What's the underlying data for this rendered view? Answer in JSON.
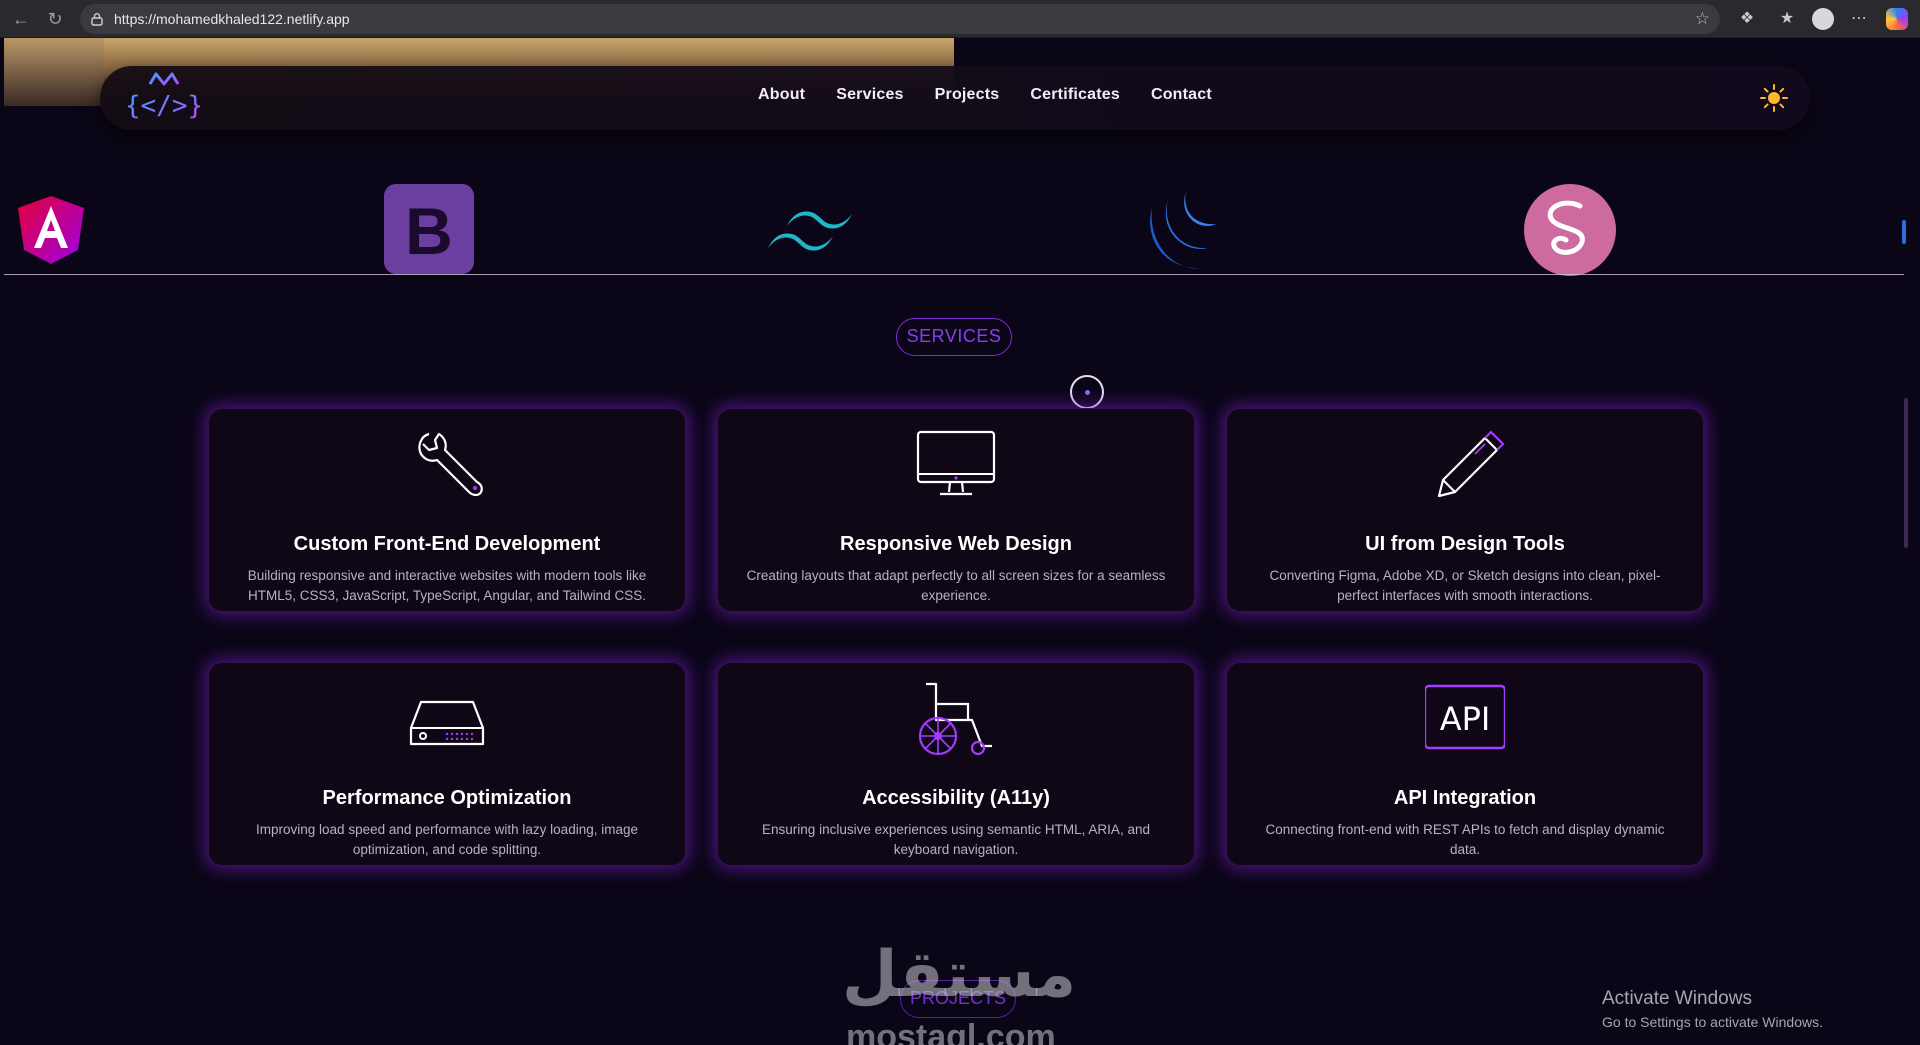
{
  "browser": {
    "url": "https://mohamedkhaled122.netlify.app",
    "back_icon": "arrow-left-icon",
    "reload_icon": "reload-icon"
  },
  "nav": {
    "links": [
      "About",
      "Services",
      "Projects",
      "Certificates",
      "Contact"
    ],
    "theme_icon": "sun-icon"
  },
  "tech_logos": [
    "angular-logo",
    "bootstrap-logo",
    "tailwind-logo",
    "jquery-logo",
    "sass-logo"
  ],
  "bootstrap_letter": "B",
  "services": {
    "badge": "SERVICES",
    "cards": [
      {
        "icon": "wrench-icon",
        "title": "Custom Front-End Development",
        "desc": "Building responsive and interactive websites with modern tools like HTML5, CSS3, JavaScript, TypeScript, Angular, and Tailwind CSS."
      },
      {
        "icon": "monitor-icon",
        "title": "Responsive Web Design",
        "desc": "Creating layouts that adapt perfectly to all screen sizes for a seamless experience."
      },
      {
        "icon": "pencil-icon",
        "title": "UI from Design Tools",
        "desc": "Converting Figma, Adobe XD, or Sketch designs into clean, pixel-perfect interfaces with smooth interactions."
      },
      {
        "icon": "hard-drive-icon",
        "title": "Performance Optimization",
        "desc": "Improving load speed and performance with lazy loading, image optimization, and code splitting."
      },
      {
        "icon": "wheelchair-icon",
        "title": "Accessibility (A11y)",
        "desc": "Ensuring inclusive experiences using semantic HTML, ARIA, and keyboard navigation."
      },
      {
        "icon": "api-icon",
        "title": "API Integration",
        "desc": "Connecting front-end with REST APIs to fetch and display dynamic data."
      }
    ],
    "api_label": "API"
  },
  "projects_badge": "PROJECTS",
  "watermark": {
    "arabic": "مستقل",
    "latin": "mostaql.com"
  },
  "activate": {
    "title": "Activate Windows",
    "subtitle": "Go to Settings to activate Windows."
  },
  "colors": {
    "accent": "#8a3ef0",
    "background": "#0b0617",
    "card_glow": "#781ec8"
  }
}
